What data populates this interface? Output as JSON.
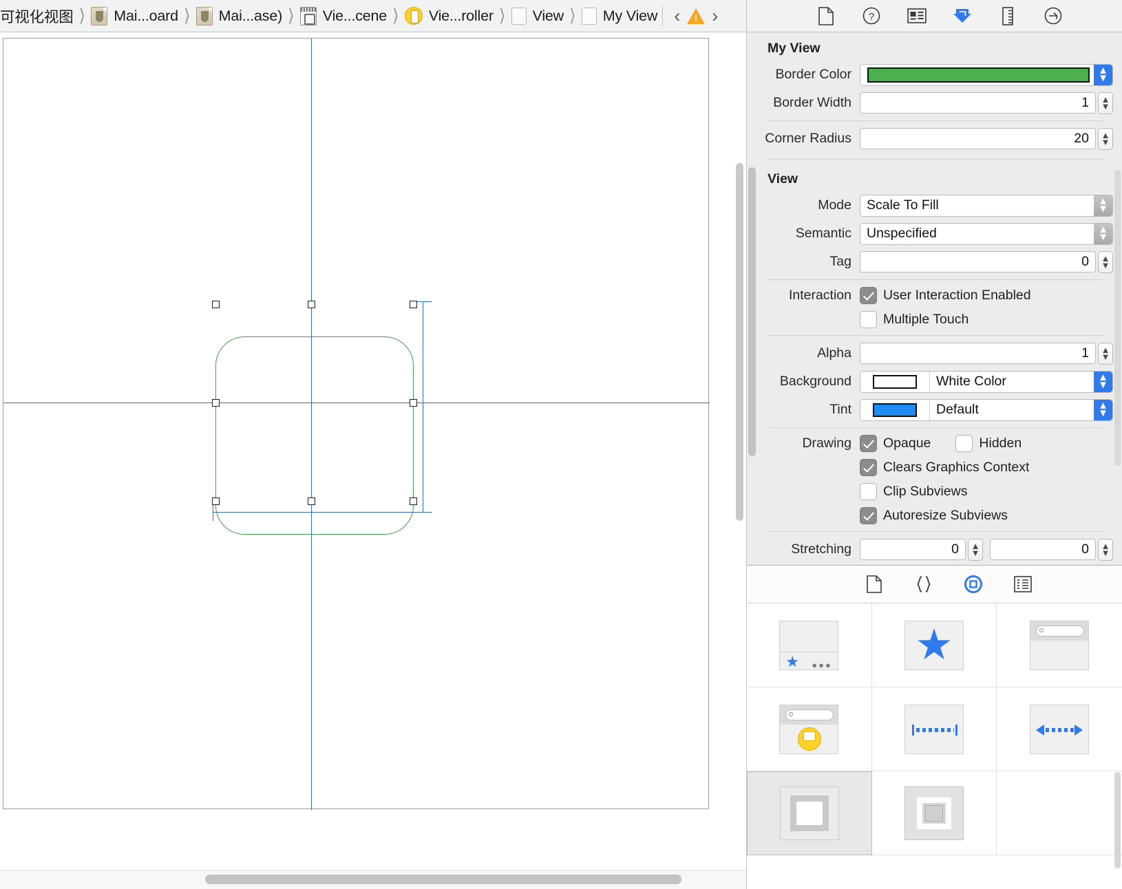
{
  "jumpbar": {
    "items": [
      {
        "label": "可视化视图",
        "icon": "none"
      },
      {
        "label": "Mai...oard",
        "icon": "storyboard-doc-icon"
      },
      {
        "label": "Mai...ase)",
        "icon": "storyboard-doc-icon"
      },
      {
        "label": "Vie...cene",
        "icon": "scene-icon"
      },
      {
        "label": "Vie...roller",
        "icon": "view-controller-icon"
      },
      {
        "label": "View",
        "icon": "view-icon"
      },
      {
        "label": "My View",
        "icon": "view-icon"
      }
    ],
    "back_chevron": "‹",
    "forward_chevron": "›",
    "warning_icon": "warning-triangle-icon"
  },
  "inspector_toolbar": {
    "icons": [
      {
        "name": "file-inspector-icon",
        "selected": false
      },
      {
        "name": "quick-help-inspector-icon",
        "selected": false
      },
      {
        "name": "identity-inspector-icon",
        "selected": false
      },
      {
        "name": "attributes-inspector-icon",
        "selected": true
      },
      {
        "name": "size-inspector-icon",
        "selected": false
      },
      {
        "name": "connections-inspector-icon",
        "selected": false
      }
    ],
    "accent_color": "#2f7bed"
  },
  "inspector": {
    "sections": [
      {
        "title": "My View",
        "rows": [
          {
            "type": "color",
            "label": "Border Color",
            "value": "",
            "color": "#4caf50"
          },
          {
            "type": "stepper",
            "label": "Border Width",
            "value": "1"
          },
          {
            "type": "divider"
          },
          {
            "type": "stepper",
            "label": "Corner Radius",
            "value": "20"
          }
        ]
      },
      {
        "title": "View",
        "rows": [
          {
            "type": "popup",
            "label": "Mode",
            "value": "Scale To Fill"
          },
          {
            "type": "popup",
            "label": "Semantic",
            "value": "Unspecified"
          },
          {
            "type": "stepper",
            "label": "Tag",
            "value": "0"
          },
          {
            "type": "divider"
          },
          {
            "type": "checkbox",
            "label": "Interaction",
            "text": "User Interaction Enabled",
            "checked": true
          },
          {
            "type": "checkbox",
            "label": "",
            "text": "Multiple Touch",
            "checked": false
          },
          {
            "type": "divider"
          },
          {
            "type": "stepper",
            "label": "Alpha",
            "value": "1"
          },
          {
            "type": "colorpopup",
            "label": "Background",
            "value": "White Color",
            "color": "#ffffff"
          },
          {
            "type": "colorpopup",
            "label": "Tint",
            "value": "Default",
            "color": "#1f8cf5"
          },
          {
            "type": "divider"
          },
          {
            "type": "checkbox2",
            "label": "Drawing",
            "text": "Opaque",
            "checked": true,
            "text2": "Hidden",
            "checked2": false
          },
          {
            "type": "checkbox",
            "label": "",
            "text": "Clears Graphics Context",
            "checked": true
          },
          {
            "type": "checkbox",
            "label": "",
            "text": "Clip Subviews",
            "checked": false
          },
          {
            "type": "checkbox",
            "label": "",
            "text": "Autoresize Subviews",
            "checked": true
          },
          {
            "type": "divider"
          },
          {
            "type": "stepper2",
            "label": "Stretching",
            "value": "0",
            "value2": "0"
          }
        ]
      }
    ]
  },
  "library": {
    "toolbar": [
      {
        "name": "file-template-library-icon",
        "selected": false
      },
      {
        "name": "code-snippet-library-icon",
        "selected": false
      },
      {
        "name": "object-library-icon",
        "selected": true
      },
      {
        "name": "media-library-icon",
        "selected": false
      }
    ],
    "items": [
      {
        "name": "object-table-view-cell",
        "thumb": "star-row-thumb",
        "selected": false
      },
      {
        "name": "object-image-view",
        "thumb": "star-thumb",
        "selected": false
      },
      {
        "name": "object-search-bar",
        "thumb": "search-bar-thumb",
        "selected": false
      },
      {
        "name": "object-search-display",
        "thumb": "search-badge-thumb",
        "selected": false
      },
      {
        "name": "object-horizontal-spacer",
        "thumb": "h-dots-thumb",
        "selected": false
      },
      {
        "name": "object-arrow-constraint",
        "thumb": "arrow-dots-thumb",
        "selected": false
      },
      {
        "name": "object-view",
        "thumb": "view-frame-thumb",
        "selected": true
      },
      {
        "name": "object-container-view",
        "thumb": "nested-frame-thumb",
        "selected": false
      },
      {
        "name": "object-empty",
        "thumb": "empty-thumb",
        "selected": false
      }
    ]
  },
  "canvas": {
    "selected_object_name": "My View",
    "border_color": "#3e9e4e",
    "guide_color": "#2c6fbb",
    "handle_count": 8
  }
}
